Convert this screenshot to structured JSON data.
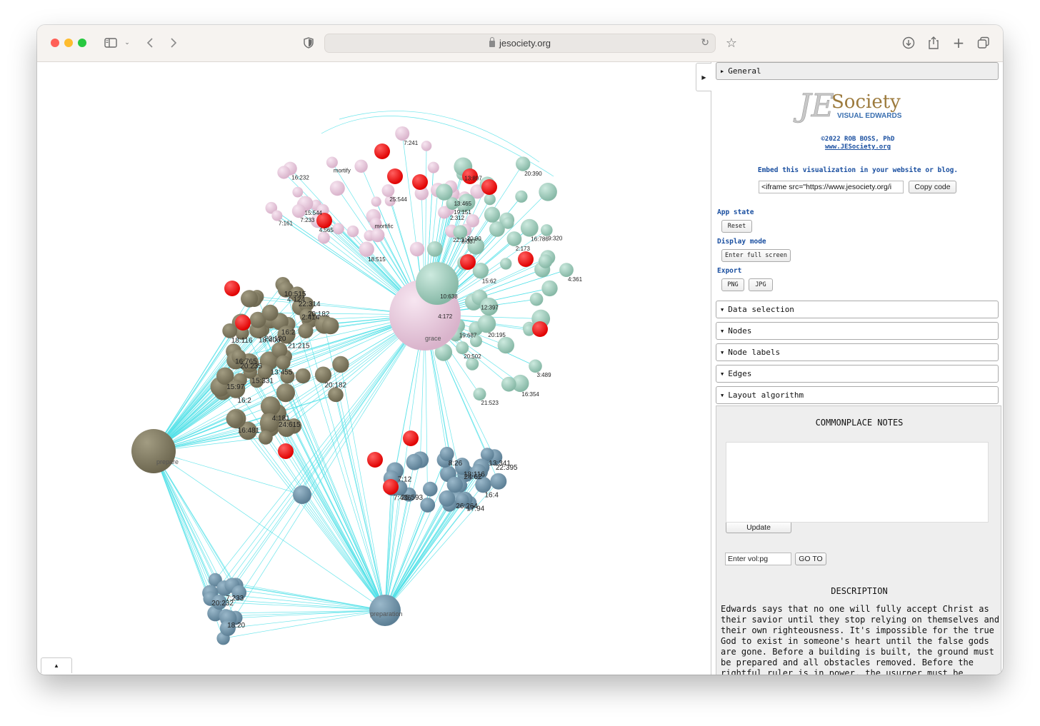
{
  "browser": {
    "url": "jesociety.org"
  },
  "graph": {
    "hub_labels": {
      "grace": "grace",
      "prepare": "prepare",
      "preparation": "preparation"
    },
    "node_labels": [
      "13:465",
      "mortific",
      "22:316",
      "15:544",
      "16:232",
      "2:312",
      "20:90",
      "4:565",
      "mortify",
      "18:515",
      "7:241",
      "7:233",
      "7:161",
      "25:544",
      "12:397",
      "21:523",
      "20:195",
      "19:687",
      "20:502",
      "16:354",
      "13:897",
      "3:489",
      "4:172",
      "8:337",
      "19:151",
      "15:62",
      "9:320",
      "16:786",
      "10:638",
      "20:390",
      "4:361",
      "2:173",
      "24:615",
      "18:406",
      "16:765",
      "13:455",
      "20:120",
      "10:515",
      "18:116",
      "4:124",
      "2:414",
      "15:331",
      "15:97",
      "16:481",
      "22:314",
      "16:2",
      "4:181",
      "20:182",
      "16:2",
      "20:182",
      "20:235",
      "21:215",
      "22:395",
      "13:341",
      "26:264",
      "7:12",
      "7:436",
      "16:4",
      "25:593",
      "17:94",
      "8:26",
      "18:116",
      "24:62",
      "18:20",
      "7:233",
      "20:232"
    ]
  },
  "panel": {
    "general_label": "General",
    "logo_text": "JESociety",
    "logo_sub": "VISUAL EDWARDS",
    "copyright": "©2022 ROB BOSS, PhD",
    "site_link": "www.JESociety.org",
    "embed_label": "Embed this visualization in your website or blog.",
    "embed_value": "<iframe src=\"https://www.jesociety.org/i",
    "copy_code": "Copy code",
    "app_state_label": "App state",
    "reset": "Reset",
    "display_mode_label": "Display mode",
    "fullscreen": "Enter full screen",
    "export_label": "Export",
    "png": "PNG",
    "jpg": "JPG",
    "sections": [
      "Data selection",
      "Nodes",
      "Node labels",
      "Edges",
      "Layout algorithm"
    ],
    "notes_title": "COMMONPLACE NOTES",
    "update": "Update",
    "vol_placeholder": "Enter vol:pg",
    "goto": "GO TO",
    "description_title": "DESCRIPTION",
    "description_text": "Edwards says that no one will fully accept Christ as their savior until they stop relying on themselves and their own righteousness. It's impossible for the true God to exist in someone's heart until the false gods are gone. Before a building is built, the ground must be prepared and all obstacles removed. Before the rightful ruler is in power, the usurper must be defeated. Before"
  },
  "colors": {
    "edge": "#4fe0e8",
    "pink_node": "#e8c9dc",
    "teal_node": "#9fcdbd",
    "olive_node": "#7d7760",
    "blue_node": "#6f92a8",
    "red_node": "#ff1010",
    "link": "#1a4fa0"
  }
}
